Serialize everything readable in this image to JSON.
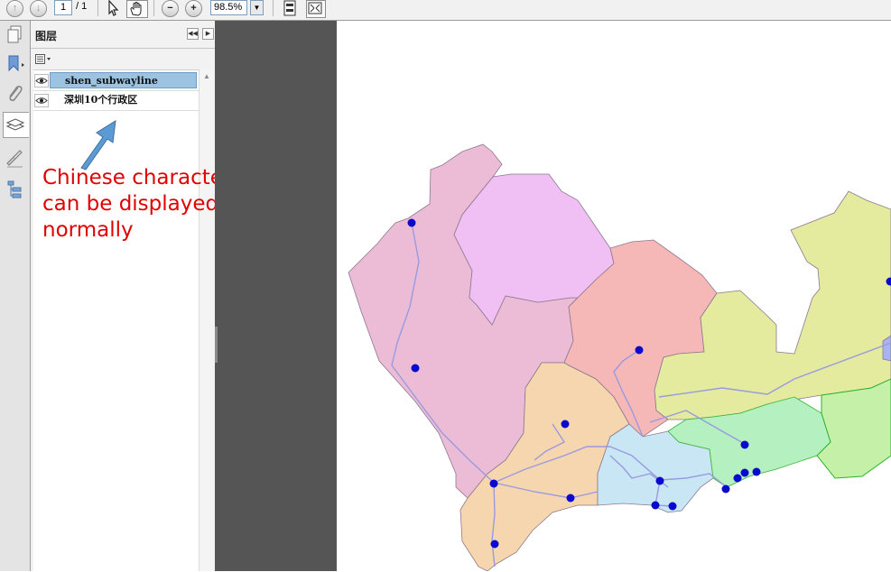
{
  "toolbar": {
    "page_current": "1",
    "page_total": "/ 1",
    "zoom": "98.5%"
  },
  "panel": {
    "title": "图层",
    "layers": [
      {
        "label": "shen_subwayline",
        "selected": true
      },
      {
        "label": "深圳10个行政区",
        "selected": false
      }
    ]
  },
  "annotation": {
    "line1": "Chinese characters",
    "line2": "can be displayed",
    "line3": "normally",
    "color": "#e00000"
  },
  "map": {
    "district_colors": [
      "#ecbcd6",
      "#f0c0f4",
      "#f6b8b6",
      "#e4ea9e",
      "#f6d6ae",
      "#c8e6f4",
      "#b4f0c0",
      "#c4f0a8",
      "#a8b4f0"
    ],
    "subway_line_color": "#9a9ae0",
    "station_color": "#0a0acc"
  }
}
